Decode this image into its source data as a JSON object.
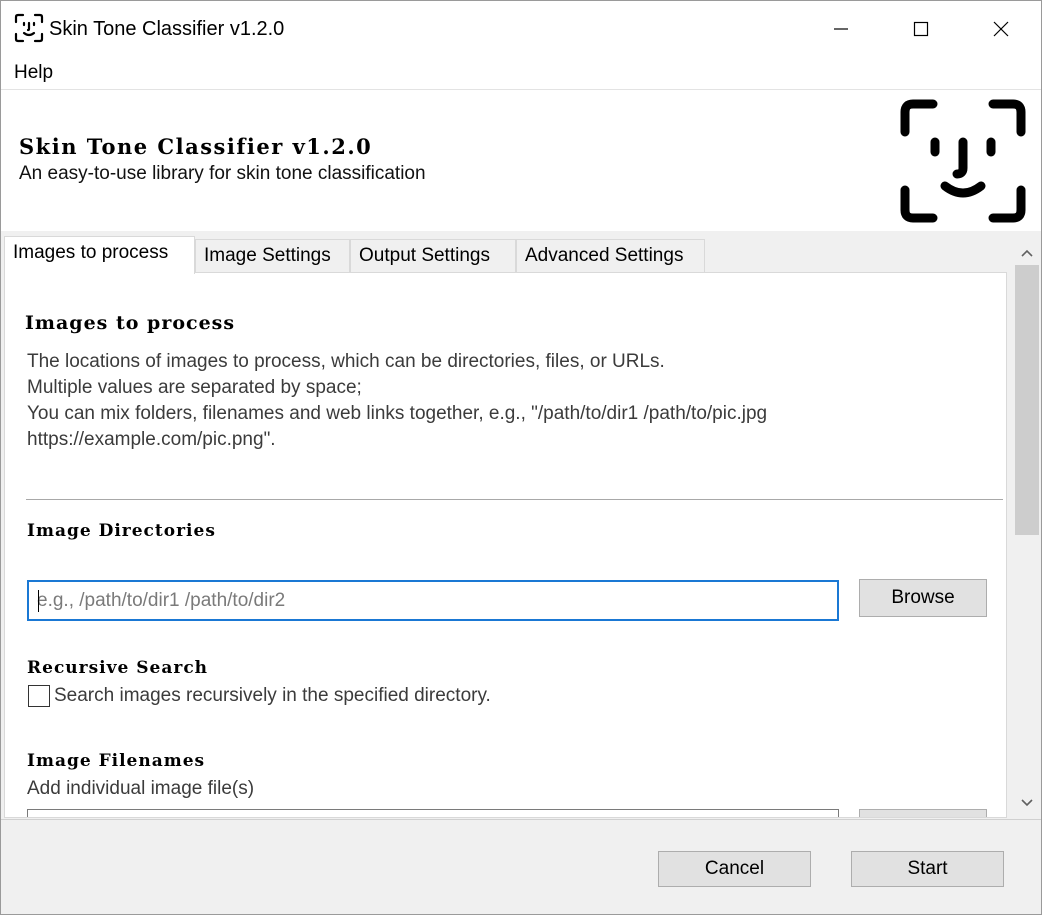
{
  "window": {
    "title": "Skin Tone Classifier v1.2.0",
    "controls": {
      "minimize": "minimize-icon",
      "maximize": "maximize-icon",
      "close": "close-icon"
    }
  },
  "menu": {
    "items": [
      {
        "label": "Help"
      }
    ]
  },
  "header": {
    "title": "Skin Tone Classifier v1.2.0",
    "subtitle": "An easy-to-use library for skin tone classification",
    "logo_icon": "face-id-icon"
  },
  "tabs": [
    {
      "label": "Images to process",
      "active": true
    },
    {
      "label": "Image Settings",
      "active": false
    },
    {
      "label": "Output Settings",
      "active": false
    },
    {
      "label": "Advanced Settings",
      "active": false
    }
  ],
  "section": {
    "title": "Images to process",
    "description_lines": [
      "The locations of images to process, which can be directories, files, or URLs.",
      "Multiple values are separated by space;",
      "You can mix folders, filenames and web links together, e.g., \"/path/to/dir1 /path/to/pic.jpg",
      "https://example.com/pic.png\"."
    ]
  },
  "image_directories": {
    "title": "Image Directories",
    "value": "",
    "placeholder": "e.g., /path/to/dir1 /path/to/dir2",
    "browse_label": "Browse"
  },
  "recursive_search": {
    "title": "Recursive Search",
    "label": "Search images recursively in the specified directory.",
    "checked": false
  },
  "image_filenames": {
    "title": "Image Filenames",
    "description": "Add individual image file(s)"
  },
  "footer": {
    "cancel_label": "Cancel",
    "start_label": "Start"
  },
  "colors": {
    "accent": "#1a78d4",
    "button_bg": "#e1e1e1",
    "window_bg": "#f0f0f0"
  }
}
